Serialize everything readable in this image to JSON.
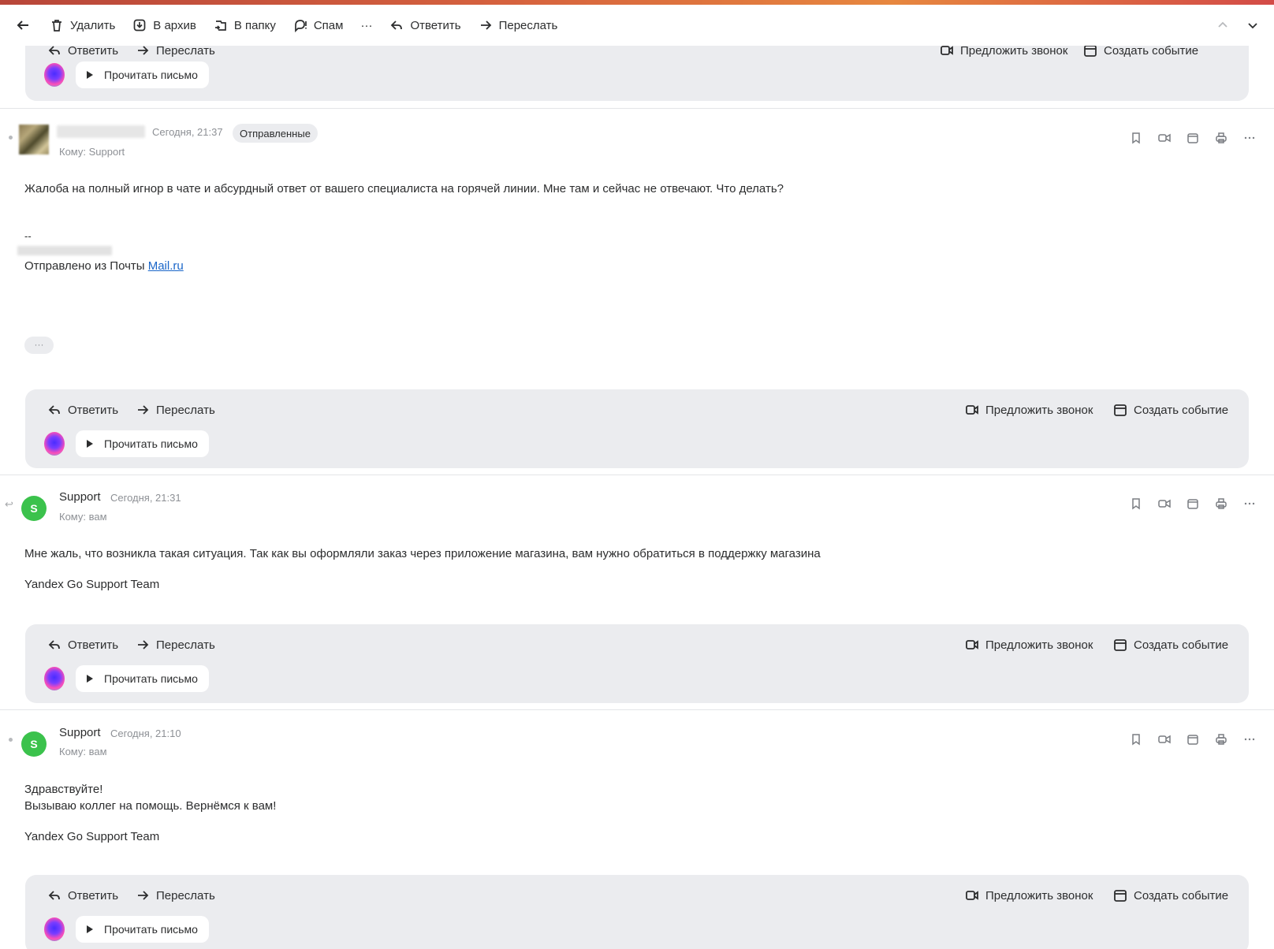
{
  "toolbar": {
    "delete": "Удалить",
    "archive": "В архив",
    "to_folder": "В папку",
    "spam": "Спам",
    "more": "···",
    "reply": "Ответить",
    "forward": "Переслать"
  },
  "actions": {
    "reply": "Ответить",
    "forward": "Переслать",
    "suggest_call": "Предложить звонок",
    "create_event": "Создать событие",
    "listen": "Прочитать письмо"
  },
  "messages": [
    {
      "date": "Сегодня, 21:37",
      "folder": "Отправленные",
      "to": "Кому: Support",
      "body": "Жалоба на полный игнор в чате и абсурдный ответ от вашего специалиста на горячей линии. Мне там и сейчас не отвечают. Что делать?",
      "sig_dash": "--",
      "sent_from": "Отправлено из Почты ",
      "sent_from_link": "Mail.ru",
      "more": "···"
    },
    {
      "sender": "Support",
      "avatar_letter": "S",
      "date": "Сегодня, 21:31",
      "to": "Кому: вам",
      "body": "Мне жаль, что возникла такая ситуация. Так как вы оформляли заказ через приложение магазина, вам нужно обратиться в поддержку магазина",
      "signature": "Yandex Go Support Team"
    },
    {
      "sender": "Support",
      "avatar_letter": "S",
      "date": "Сегодня, 21:10",
      "to": "Кому: вам",
      "body_line1": "Здравствуйте!",
      "body_line2": "Вызываю коллег на помощь. Вернёмся к вам!",
      "signature": "Yandex Go Support Team"
    }
  ],
  "colors": {
    "avatar_green": "#3bc24c",
    "panel_bg": "#ebecef",
    "link": "#1a66c9"
  }
}
